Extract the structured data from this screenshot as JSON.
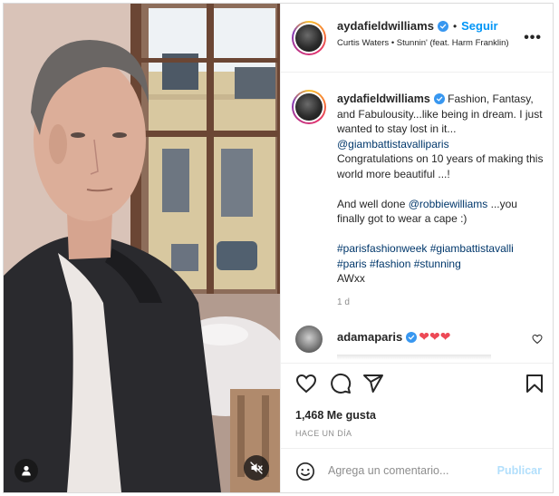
{
  "post": {
    "author": {
      "username": "aydafieldwilliams",
      "follow_label": "Seguir",
      "separator": "•",
      "audio": "Curtis Waters • Stunnin' (feat. Harm Franklin)"
    },
    "more_glyph": "•••",
    "caption": {
      "username": "aydafieldwilliams",
      "line1": " Fashion, Fantasy, and Fabulousity...like being in dream. I just wanted to stay lost in it...",
      "mention1": "@giambattistavalliparis",
      "line2": "Congratulations on 10 years of making this world more beautiful ...!",
      "line3a": "And well done ",
      "mention2": "@robbiewilliams",
      "line3b": " ...you finally got to wear a cape :)",
      "hashtags_row1": "#parisfashionweek #giambattistavalli",
      "hashtags_row2": "#paris #fashion #stunning",
      "signoff": "AWxx",
      "age": "1 d"
    },
    "comment": {
      "username": "adamaparis",
      "text": "❤️❤️❤️",
      "hearts": "❤❤❤"
    },
    "likes": "1,468 Me gusta",
    "timestamp": "HACE UN DÍA",
    "add_comment": {
      "placeholder": "Agrega un comentario...",
      "publish_label": "Publicar"
    },
    "icons": {
      "like": "heart-outline-icon",
      "comment": "speech-bubble-icon",
      "share": "paper-plane-icon",
      "save": "bookmark-icon",
      "emoji": "smiley-icon",
      "mute": "speaker-muted-icon",
      "tags": "person-icon",
      "verified": "verified-badge-icon"
    },
    "colors": {
      "link_blue": "#0095f6",
      "hashtag": "#00376b",
      "verified": "#3897f0",
      "heart": "#ed4956",
      "publish_disabled": "#b2dffc"
    }
  }
}
